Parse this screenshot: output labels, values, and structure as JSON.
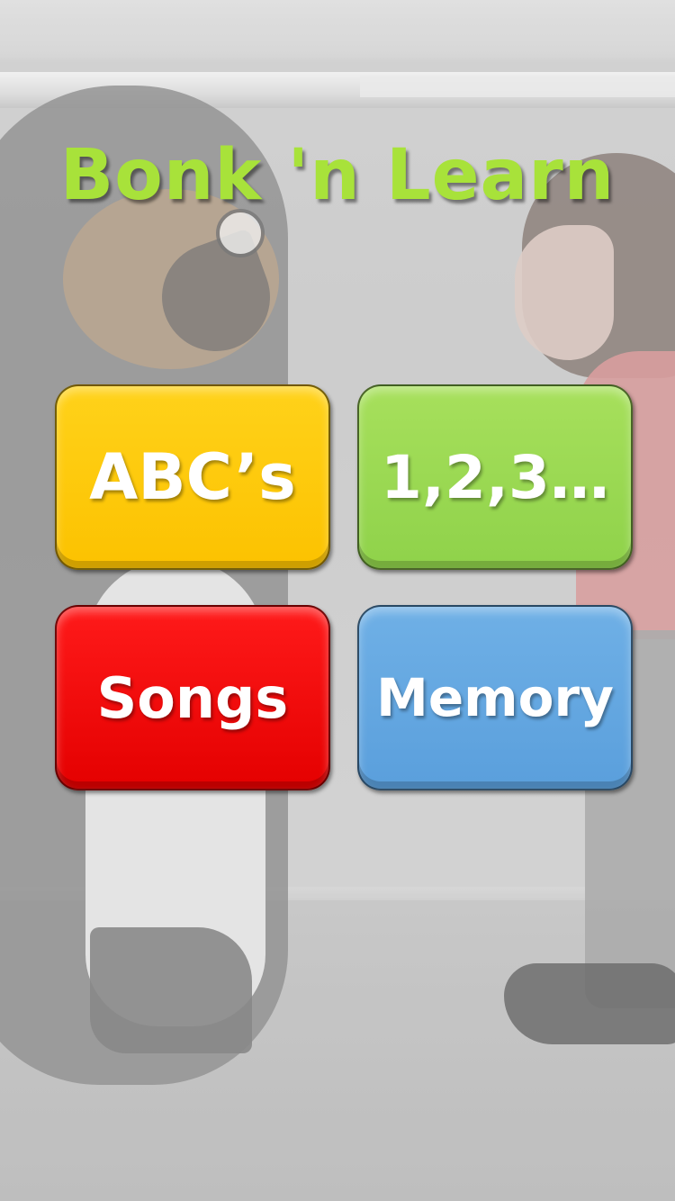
{
  "app": {
    "title": "Bonk 'n Learn"
  },
  "menu": {
    "buttons": [
      {
        "label": "ABC’s",
        "color": "#fcc200"
      },
      {
        "label": "1,2,3…",
        "color": "#8fd24a"
      },
      {
        "label": "Songs",
        "color": "#e40000"
      },
      {
        "label": "Memory",
        "color": "#5a9fdc"
      }
    ]
  },
  "theme": {
    "title_color": "#a8e23a"
  }
}
